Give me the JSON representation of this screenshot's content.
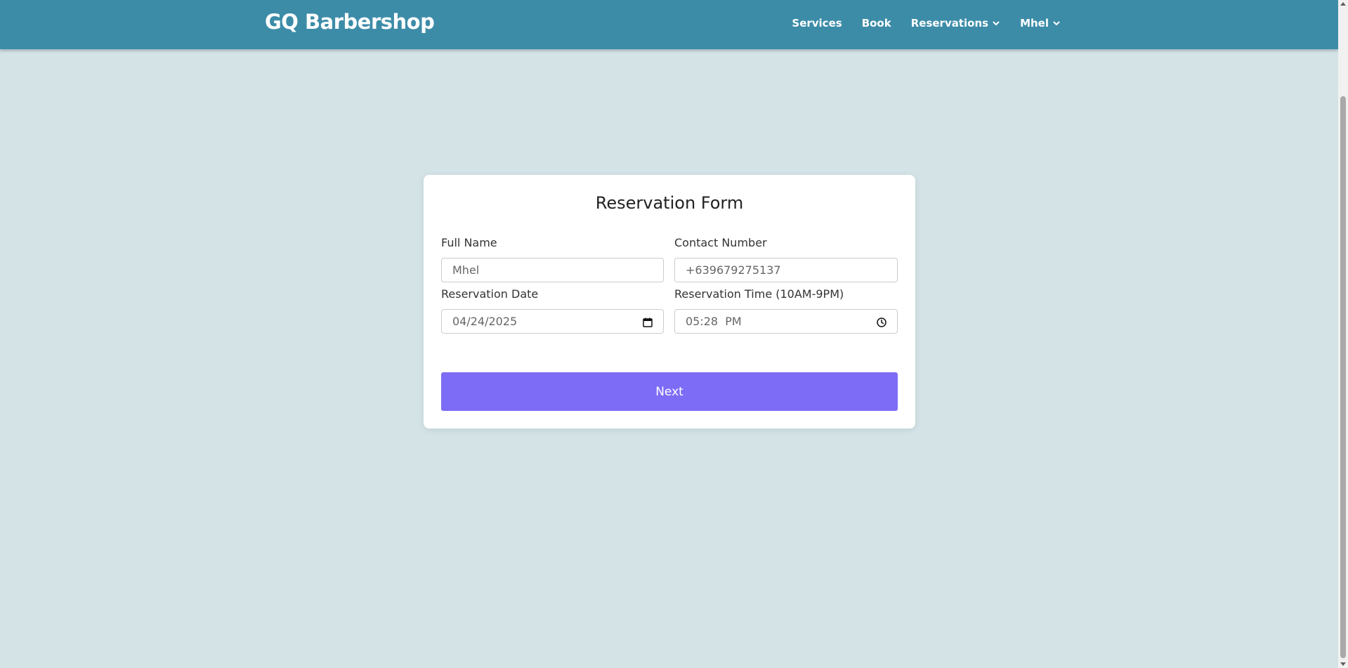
{
  "navbar": {
    "brand": "GQ Barbershop",
    "links": [
      {
        "label": "Services"
      },
      {
        "label": "Book"
      },
      {
        "label": "Reservations"
      },
      {
        "label": "Mhel"
      }
    ]
  },
  "form": {
    "title": "Reservation Form",
    "full_name": {
      "label": "Full Name",
      "value": "Mhel"
    },
    "contact": {
      "label": "Contact Number",
      "value": "+639679275137"
    },
    "date": {
      "label": "Reservation Date",
      "value": "04/24/2025",
      "icon": "calendar-icon"
    },
    "time": {
      "label": "Reservation Time (10AM-9PM)",
      "value": "05:28  PM",
      "icon": "clock-icon"
    },
    "next_label": "Next"
  },
  "colors": {
    "navbar": "#3c8ca8",
    "background": "#d3e3e6",
    "button": "#7d6cf5"
  }
}
